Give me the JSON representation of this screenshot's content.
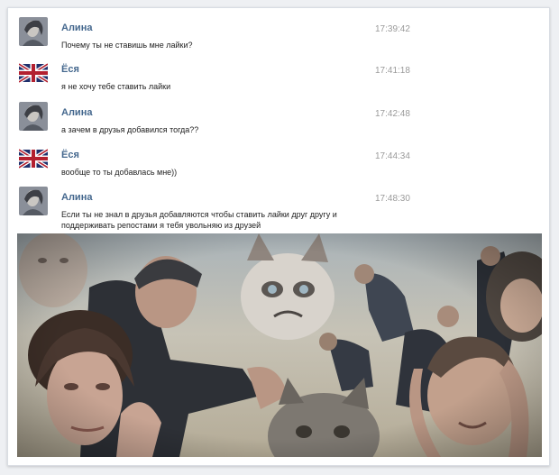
{
  "messages": [
    {
      "author": "Алина",
      "time": "17:39:42",
      "text": "Почему ты не ставишь мне лайки?",
      "avatar": "person-photo"
    },
    {
      "author": "Ёся",
      "time": "17:41:18",
      "text": "я не хочу тебе ставить лайки",
      "avatar": "uk-flag"
    },
    {
      "author": "Алина",
      "time": "17:42:48",
      "text": "а зачем в друзья добавился тогда??",
      "avatar": "person-photo"
    },
    {
      "author": "Ёся",
      "time": "17:44:34",
      "text": "вообще то ты добавлась мне))",
      "avatar": "uk-flag"
    },
    {
      "author": "Алина",
      "time": "17:48:30",
      "text": "Если ты не знал в друзья добавляются чтобы ставить лайки друг другу и поддерживать репостами я тебя увольняю из друзей",
      "avatar": "person-photo"
    }
  ],
  "colors": {
    "author_link": "#45688e",
    "time": "#9a9a9a",
    "message_text": "#222222"
  },
  "meme_image": "collage-facepalm-crying-people-grumpy-cat"
}
